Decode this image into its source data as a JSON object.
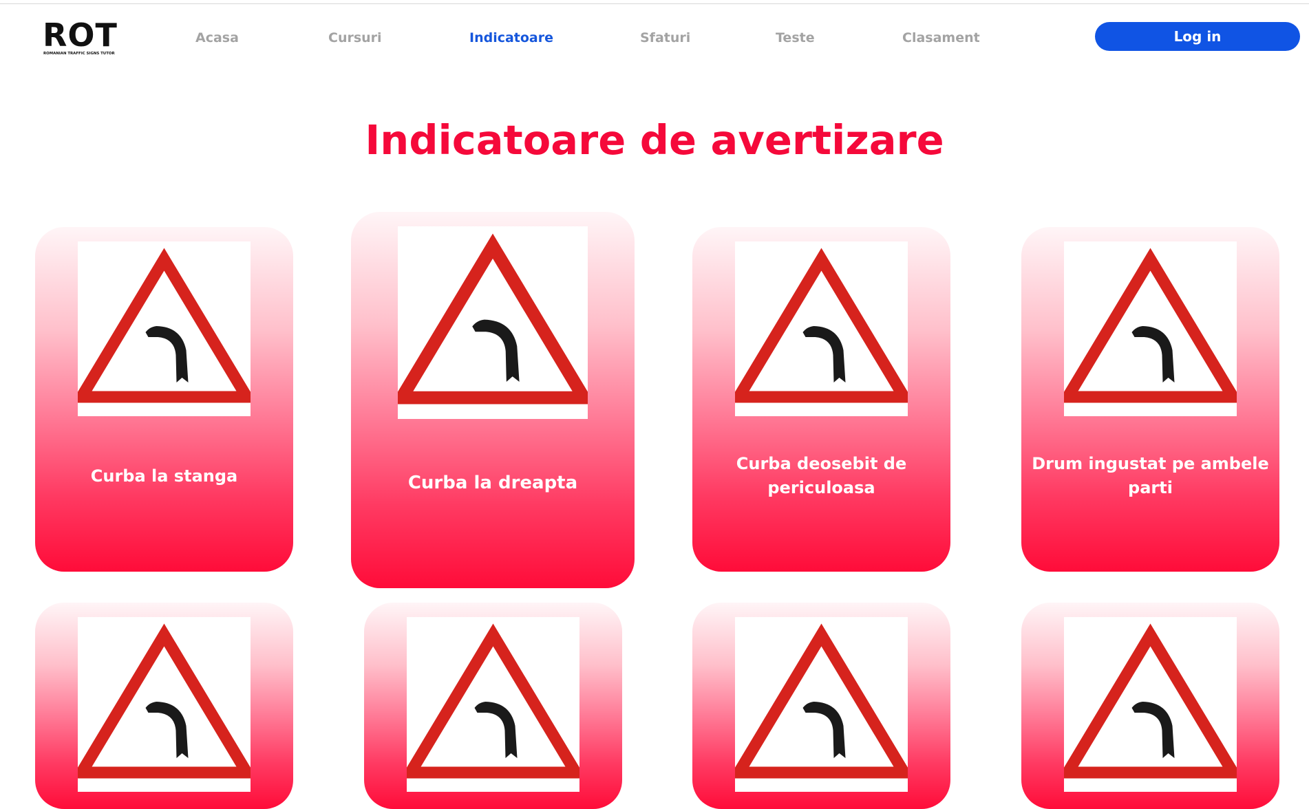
{
  "logo": {
    "word": "ROT",
    "tagline": "ROMANIAN TRAFFIC SIGNS TUTOR"
  },
  "nav": {
    "items": [
      {
        "label": "Acasa"
      },
      {
        "label": "Cursuri"
      },
      {
        "label": "Indicatoare",
        "active": true
      },
      {
        "label": "Sfaturi"
      },
      {
        "label": "Teste"
      },
      {
        "label": "Clasament"
      }
    ],
    "login_label": "Log in"
  },
  "page": {
    "title": "Indicatoare de avertizare"
  },
  "cards": [
    {
      "label": "Curba la stanga"
    },
    {
      "label": "Curba la dreapta"
    },
    {
      "label": "Curba deosebit de periculoasa"
    },
    {
      "label": "Drum ingustat pe ambele parti"
    }
  ],
  "colors": {
    "accent_title": "#f5093a",
    "nav_active": "#1556dc",
    "nav_inactive": "#a3a3a3",
    "login_button": "#1054e4",
    "card_gradient_top": "#fff5f7",
    "card_gradient_bottom": "#ff0c39",
    "sign_red": "#d6231d",
    "sign_symbol": "#1a1a1a"
  },
  "icons": {
    "sign": "warning-curve-sign-icon"
  }
}
